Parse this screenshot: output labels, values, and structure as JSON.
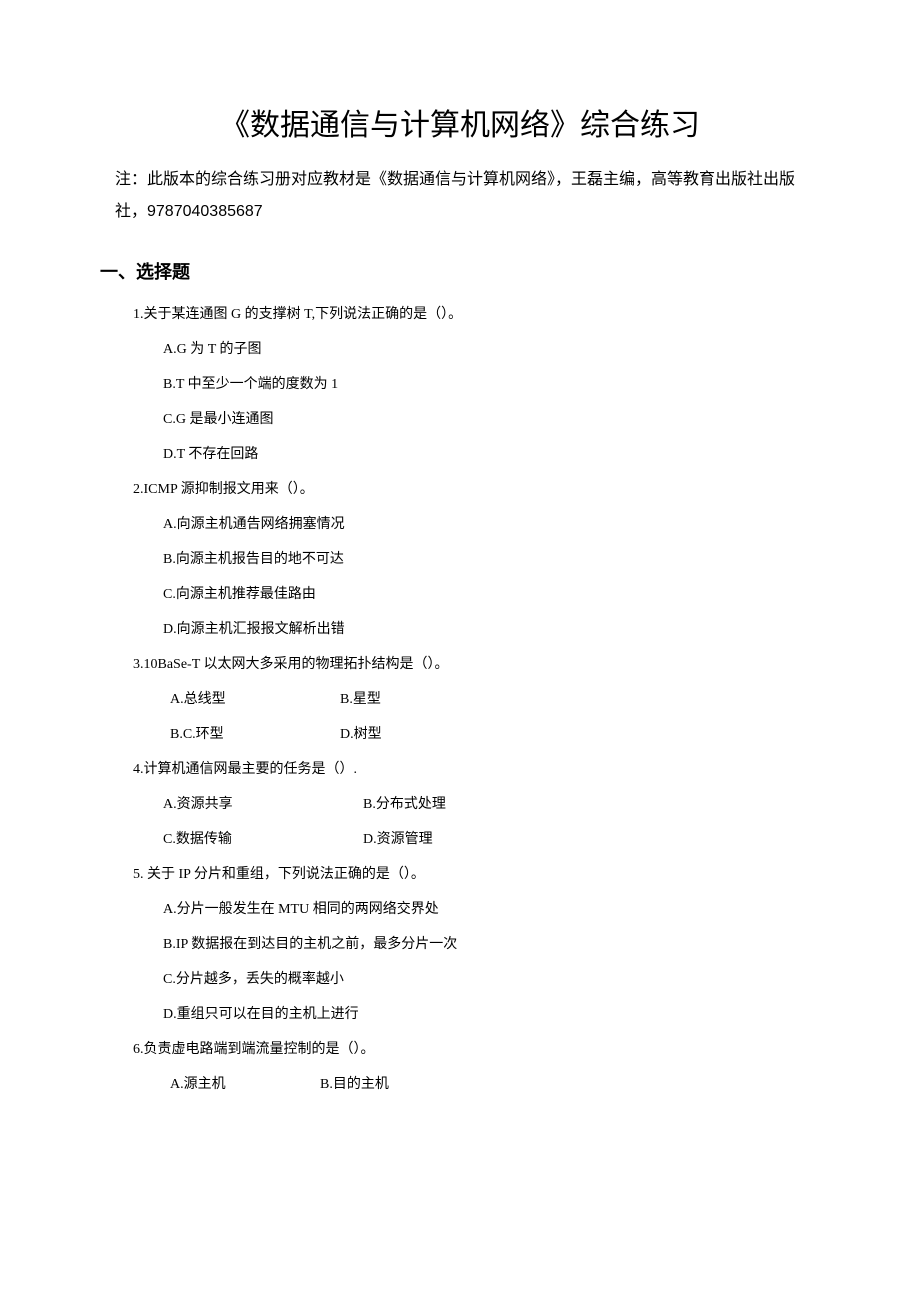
{
  "title": "《数据通信与计算机网络》综合练习",
  "note": "注：此版本的综合练习册对应教材是《数据通信与计算机网络》，王磊主编，高等教育出版社出版社，9787040385687",
  "section_heading": "一、选择题",
  "questions": [
    {
      "text": "1.关于某连通图 G 的支撑树 T,下列说法正确的是（）。",
      "layout": "vertical",
      "options": [
        "A.G 为 T 的子图",
        "B.T 中至少一个端的度数为 1",
        "C.G 是最小连通图",
        "D.T 不存在回路"
      ]
    },
    {
      "text": "2.ICMP 源抑制报文用来（）。",
      "layout": "vertical",
      "options": [
        "A.向源主机通告网络拥塞情况",
        "B.向源主机报告目的地不可达",
        "C.向源主机推荐最佳路由",
        "D.向源主机汇报报文解析出错"
      ]
    },
    {
      "text": "3.10BaSe-T 以太网大多采用的物理拓扑结构是（）。",
      "layout": "row2",
      "rows": [
        [
          "A.总线型",
          "B.星型"
        ],
        [
          "B.C.环型",
          "D.树型"
        ]
      ]
    },
    {
      "text": "4.计算机通信网最主要的任务是（）.",
      "layout": "row2b",
      "rows": [
        [
          "A.资源共享",
          "B.分布式处理"
        ],
        [
          "C.数据传输",
          "D.资源管理"
        ]
      ]
    },
    {
      "text": "5. 关于 IP 分片和重组，下列说法正确的是（）。",
      "layout": "vertical",
      "options": [
        "A.分片一般发生在 MTU 相同的两网络交界处",
        "B.IP 数据报在到达目的主机之前，最多分片一次",
        "C.分片越多，丢失的概率越小",
        "D.重组只可以在目的主机上进行"
      ]
    },
    {
      "text": "6.负责虚电路端到端流量控制的是（）。",
      "layout": "row1",
      "rows": [
        [
          "A.源主机",
          "B.目的主机"
        ]
      ]
    }
  ]
}
